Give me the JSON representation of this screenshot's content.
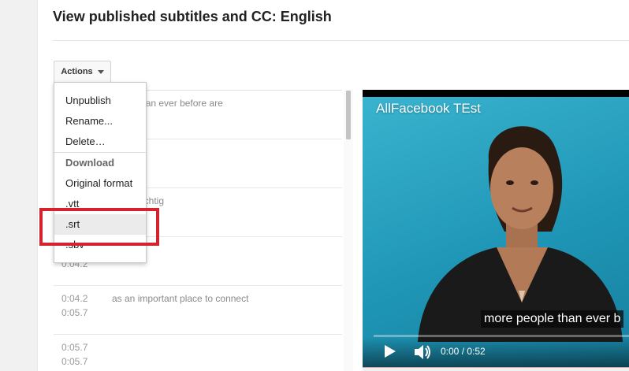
{
  "page": {
    "title": "View published subtitles and CC: English"
  },
  "toolbar": {
    "actions_label": "Actions"
  },
  "menu": {
    "unpublish": "Unpublish",
    "rename": "Rename...",
    "delete": "Delete…",
    "download_header": "Download",
    "original_format": "Original format",
    "vtt": ".vtt",
    "srt": ".srt",
    "sbv": ".sbv"
  },
  "subtitles": [
    {
      "start": "",
      "end": "",
      "text": "eople than ever before are"
    },
    {
      "start": "",
      "end": "",
      "text": ""
    },
    {
      "start": "",
      "end": "",
      "text": "ur ist wichtig"
    },
    {
      "start": "",
      "end": "0:04.2",
      "text": ""
    },
    {
      "start": "0:04.2",
      "end": "0:05.7",
      "text": "as an important place to connect"
    },
    {
      "start": "0:05.7",
      "end": "0:05.7",
      "text": ""
    }
  ],
  "player": {
    "video_title": "AllFacebook TEst",
    "caption": "more people than ever b",
    "time": "0:00 / 0:52",
    "progress": 0.0
  },
  "colors": {
    "highlight": "#d4232f",
    "video_bg": "#2aa5c4"
  },
  "icons": {
    "actions_caret": "caret-down-icon",
    "play": "play-icon",
    "volume": "volume-icon"
  }
}
